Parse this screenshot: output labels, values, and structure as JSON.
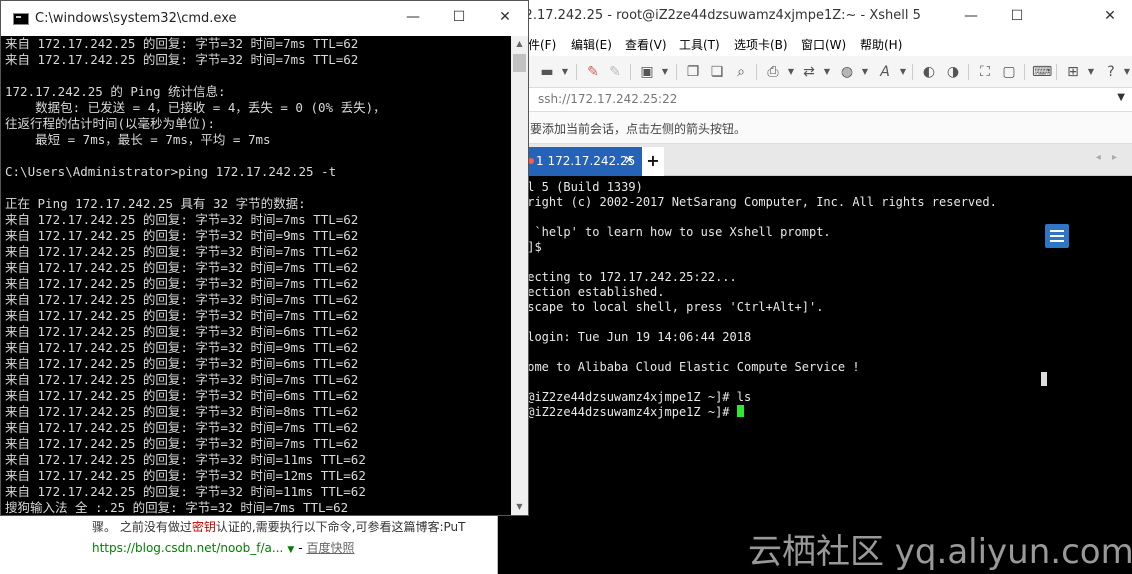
{
  "background_page": {
    "snippet_prefix": "骤。 之前没有做过",
    "snippet_highlight": "密钥",
    "snippet_suffix": "认证的,需要执行以下命令,可参看这篇博客:PuT",
    "link_url": "https://blog.csdn.net/noob_f/a...",
    "link_arrow": "▼",
    "link_sep": "-",
    "link_snapshot": "百度快照"
  },
  "xshell": {
    "title": "172.17.242.25 - root@iZ2ze44dzsuwamz4xjmpe1Z:~ - Xshell 5",
    "window_buttons": {
      "minimize": "—",
      "maximize": "☐",
      "close": "✕"
    },
    "menu": [
      "件(F)",
      "编辑(E)",
      "查看(V)",
      "工具(T)",
      "选项卡(B)",
      "窗口(W)",
      "帮助(H)"
    ],
    "address": "ssh://172.17.242.25:22",
    "address_dropdown": "▼",
    "hint": "要添加当前会话，点击左侧的箭头按钮。",
    "tab_label": "1 172.17.242.25",
    "tab_close": "✕",
    "new_tab": "+",
    "tab_nav": "◂ ▸",
    "terminal_lines": [
      "ll 5 (Build 1339)",
      "yright (c) 2002-2017 NetSarang Computer, Inc. All rights reserved.",
      "",
      "e `help' to learn how to use Xshell prompt.",
      "~]$",
      "",
      "necting to 172.17.242.25:22...",
      "nection established.",
      "escape to local shell, press 'Ctrl+Alt+]'.",
      "",
      " login: Tue Jun 19 14:06:44 2018",
      "",
      "come to Alibaba Cloud Elastic Compute Service !",
      "",
      "t@iZ2ze44dzsuwamz4xjmpe1Z ~]# ls"
    ],
    "terminal_prompt": "t@iZ2ze44dzsuwamz4xjmpe1Z ~]# "
  },
  "watermark": "云栖社区 yq.aliyun.com",
  "cmd": {
    "title": "C:\\windows\\system32\\cmd.exe",
    "window_buttons": {
      "minimize": "—",
      "maximize": "☐",
      "close": "✕"
    },
    "lines": [
      "来自 172.17.242.25 的回复: 字节=32 时间=7ms TTL=62",
      "来自 172.17.242.25 的回复: 字节=32 时间=7ms TTL=62",
      "",
      "172.17.242.25 的 Ping 统计信息:",
      "    数据包: 已发送 = 4，已接收 = 4，丢失 = 0 (0% 丢失)，",
      "往返行程的估计时间(以毫秒为单位):",
      "    最短 = 7ms，最长 = 7ms，平均 = 7ms",
      "",
      "C:\\Users\\Administrator>ping 172.17.242.25 -t",
      "",
      "正在 Ping 172.17.242.25 具有 32 字节的数据:",
      "来自 172.17.242.25 的回复: 字节=32 时间=7ms TTL=62",
      "来自 172.17.242.25 的回复: 字节=32 时间=9ms TTL=62",
      "来自 172.17.242.25 的回复: 字节=32 时间=7ms TTL=62",
      "来自 172.17.242.25 的回复: 字节=32 时间=7ms TTL=62",
      "来自 172.17.242.25 的回复: 字节=32 时间=7ms TTL=62",
      "来自 172.17.242.25 的回复: 字节=32 时间=7ms TTL=62",
      "来自 172.17.242.25 的回复: 字节=32 时间=7ms TTL=62",
      "来自 172.17.242.25 的回复: 字节=32 时间=6ms TTL=62",
      "来自 172.17.242.25 的回复: 字节=32 时间=9ms TTL=62",
      "来自 172.17.242.25 的回复: 字节=32 时间=6ms TTL=62",
      "来自 172.17.242.25 的回复: 字节=32 时间=7ms TTL=62",
      "来自 172.17.242.25 的回复: 字节=32 时间=6ms TTL=62",
      "来自 172.17.242.25 的回复: 字节=32 时间=8ms TTL=62",
      "来自 172.17.242.25 的回复: 字节=32 时间=7ms TTL=62",
      "来自 172.17.242.25 的回复: 字节=32 时间=7ms TTL=62",
      "来自 172.17.242.25 的回复: 字节=32 时间=11ms TTL=62",
      "来自 172.17.242.25 的回复: 字节=32 时间=12ms TTL=62",
      "来自 172.17.242.25 的回复: 字节=32 时间=11ms TTL=62",
      "搜狗输入法 全 :.25 的回复: 字节=32 时间=7ms TTL=62"
    ],
    "scroll_up": "▲",
    "scroll_down": "▼"
  }
}
